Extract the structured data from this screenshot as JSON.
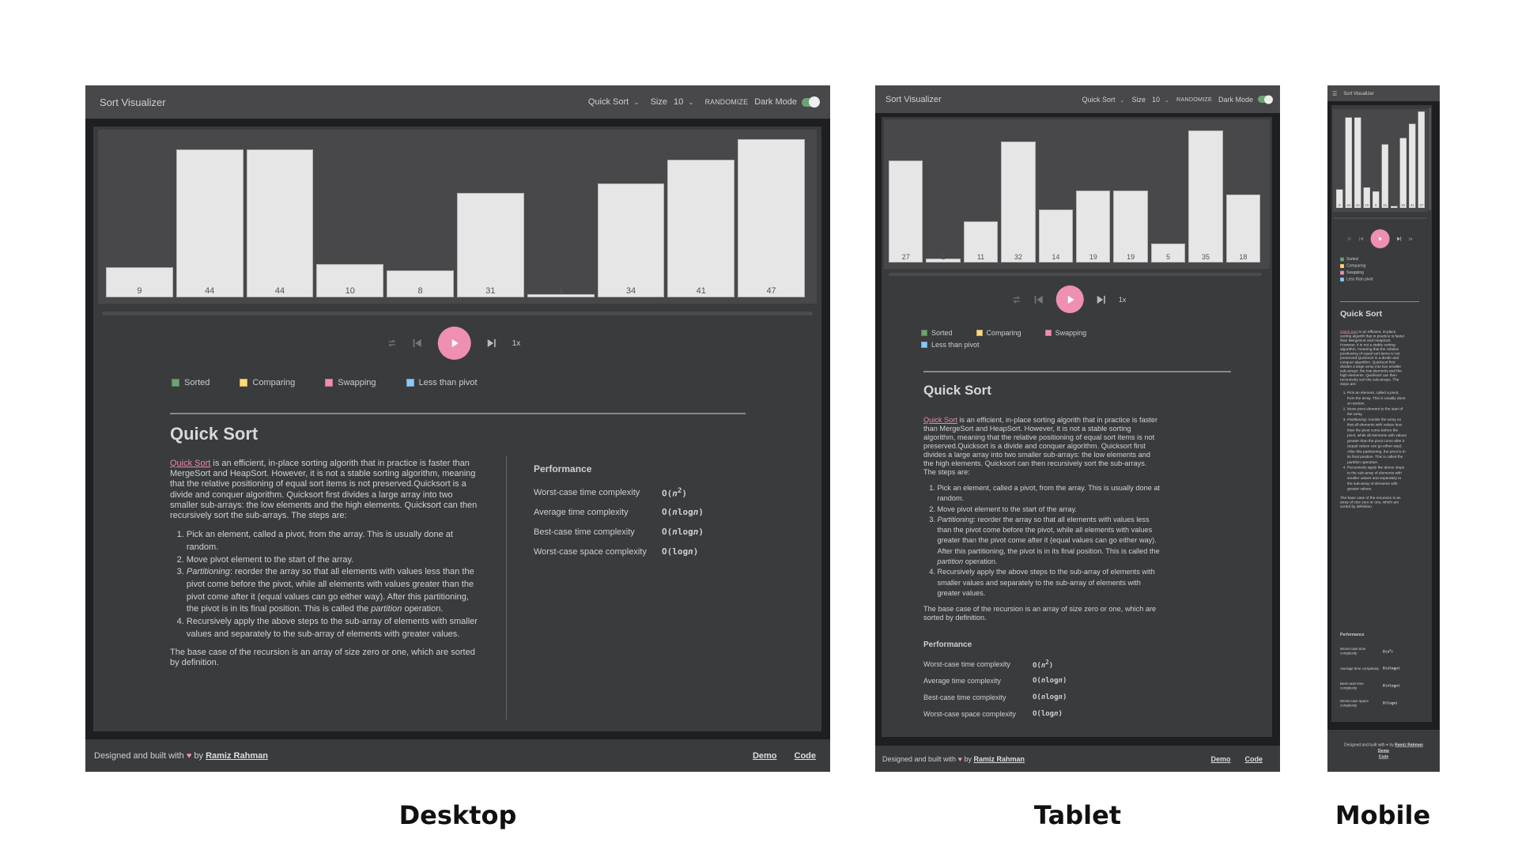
{
  "captions": {
    "desktop": "Desktop",
    "tablet": "Tablet",
    "mobile": "Mobile"
  },
  "header": {
    "title": "Sort Visualizer",
    "algorithm": "Quick Sort",
    "size_label": "Size",
    "size_value": "10",
    "randomize": "RANDOMIZE",
    "dark_mode_label": "Dark Mode",
    "dark_mode_on": true,
    "menu_icon": "hamburger-icon"
  },
  "controls": {
    "icons": [
      "repeat-icon",
      "skip-previous-icon",
      "play-icon",
      "skip-next-icon"
    ],
    "speed": "1x",
    "play_color": "#ee8fb3",
    "progress": 0
  },
  "legend": [
    {
      "label": "Sorted",
      "color": "#6da274"
    },
    {
      "label": "Comparing",
      "color": "#ffd97a"
    },
    {
      "label": "Swapping",
      "color": "#ef8fb0"
    },
    {
      "label": "Less than pivot",
      "color": "#8cc8f8"
    }
  ],
  "description": {
    "title": "Quick Sort",
    "link": "Quick Sort",
    "intro": " is an efficient, in-place sorting algorith that in practice is faster than MergeSort and HeapSort. However, it is not a stable sorting algorithm, meaning that the relative positioning of equal sort items is not preserved.Quicksort is a divide and conquer algorithm. Quicksort first divides a large array into two smaller sub-arrays: the low elements and the high elements. Quicksort can then recursively sort the sub-arrays. The steps are:",
    "steps": [
      {
        "text": "Pick an element, called a pivot, from the array. This is usually done at random."
      },
      {
        "text": "Move pivot element to the start of the array."
      },
      {
        "em": "Partitioning",
        "text": ": reorder the array so that all elements with values less than the pivot come before the pivot, while all elements with values greater than the pivot come after it (equal values can go either way). After this partitioning, the pivot is in its final position. This is called the ",
        "em2": "partition",
        "tail": " operation."
      },
      {
        "text": "Recursively apply the above steps to the sub-array of elements with smaller values and separately to the sub-array of elements with greater values."
      }
    ],
    "outro": "The base case of the recursion is an array of size zero or one, which are sorted by definition."
  },
  "performance": {
    "title": "Performance",
    "rows": [
      {
        "label": "Worst-case time complexity",
        "parts": [
          {
            "t": "O("
          },
          {
            "t": "n",
            "i": true
          },
          {
            "t": "2",
            "sup": true
          },
          {
            "t": ")"
          }
        ]
      },
      {
        "label": "Average time complexity",
        "parts": [
          {
            "t": "O("
          },
          {
            "t": "n",
            "i": true
          },
          {
            "t": "log"
          },
          {
            "t": "n",
            "i": true
          },
          {
            "t": ")"
          }
        ]
      },
      {
        "label": "Best-case time complexity",
        "parts": [
          {
            "t": "O("
          },
          {
            "t": "n",
            "i": true
          },
          {
            "t": "log"
          },
          {
            "t": "n",
            "i": true
          },
          {
            "t": ")"
          }
        ]
      },
      {
        "label": "Worst-case space complexity",
        "parts": [
          {
            "t": "O(log"
          },
          {
            "t": "n",
            "i": true
          },
          {
            "t": ")"
          }
        ]
      }
    ]
  },
  "footer": {
    "designed": "Designed and built with",
    "heart_icon": "heart-icon",
    "by": "by",
    "author": "Ramiz Rahman",
    "demo": "Demo",
    "code": "Code"
  },
  "chart_data": [
    {
      "type": "bar",
      "view": "Desktop",
      "values": [
        9,
        44,
        44,
        10,
        8,
        31,
        1,
        34,
        41,
        47
      ],
      "bar_color": "#e6e6e6"
    },
    {
      "type": "bar",
      "view": "Tablet",
      "values": [
        27,
        1,
        11,
        32,
        14,
        19,
        19,
        5,
        35,
        18
      ],
      "bar_color": "#e6e6e6"
    },
    {
      "type": "bar",
      "view": "Mobile",
      "values": [
        9,
        44,
        44,
        10,
        8,
        31,
        1,
        34,
        41,
        47
      ],
      "bar_color": "#e6e6e6"
    }
  ]
}
